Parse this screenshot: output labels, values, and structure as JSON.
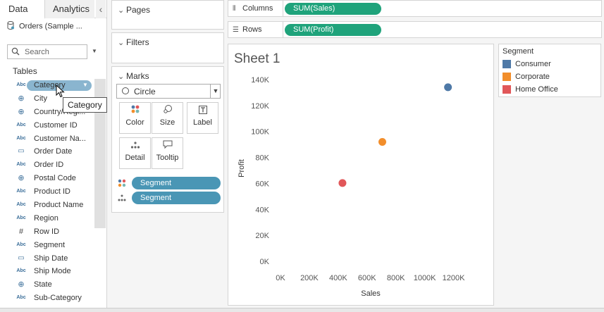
{
  "data_pane": {
    "tabs": [
      {
        "label": "Data"
      },
      {
        "label": "Analytics"
      }
    ],
    "collapse_glyph": "‹",
    "datasource": "Orders (Sample ...",
    "search": {
      "placeholder": "Search"
    },
    "tables_header": "Tables",
    "fields": [
      {
        "name": "Category",
        "type": "Abc",
        "icon": "abc-icon"
      },
      {
        "name": "City",
        "type": "globe",
        "icon": "globe-icon"
      },
      {
        "name": "Country/Regi...",
        "type": "globe",
        "icon": "globe-icon"
      },
      {
        "name": "Customer ID",
        "type": "Abc",
        "icon": "abc-icon"
      },
      {
        "name": "Customer Na...",
        "type": "Abc",
        "icon": "abc-icon"
      },
      {
        "name": "Order Date",
        "type": "date",
        "icon": "calendar-icon"
      },
      {
        "name": "Order ID",
        "type": "Abc",
        "icon": "abc-icon"
      },
      {
        "name": "Postal Code",
        "type": "globe",
        "icon": "globe-icon"
      },
      {
        "name": "Product ID",
        "type": "Abc",
        "icon": "abc-icon"
      },
      {
        "name": "Product Name",
        "type": "Abc",
        "icon": "abc-icon"
      },
      {
        "name": "Region",
        "type": "Abc",
        "icon": "abc-icon"
      },
      {
        "name": "Row ID",
        "type": "number",
        "icon": "hash-icon"
      },
      {
        "name": "Segment",
        "type": "Abc",
        "icon": "abc-icon"
      },
      {
        "name": "Ship Date",
        "type": "date",
        "icon": "calendar-icon"
      },
      {
        "name": "Ship Mode",
        "type": "Abc",
        "icon": "abc-icon"
      },
      {
        "name": "State",
        "type": "globe",
        "icon": "globe-icon"
      },
      {
        "name": "Sub-Category",
        "type": "Abc",
        "icon": "abc-icon"
      }
    ],
    "tooltip": "Category"
  },
  "cards": {
    "pages": "Pages",
    "filters": "Filters",
    "marks": "Marks",
    "mark_type": "Circle",
    "buttons": {
      "color": "Color",
      "size": "Size",
      "label": "Label",
      "detail": "Detail",
      "tooltip": "Tooltip"
    },
    "mark_pills": [
      {
        "label": "Segment",
        "encoding": "color"
      },
      {
        "label": "Segment",
        "encoding": "detail"
      }
    ]
  },
  "shelves": {
    "columns": {
      "label": "Columns",
      "pill": "SUM(Sales)"
    },
    "rows": {
      "label": "Rows",
      "pill": "SUM(Profit)"
    }
  },
  "sheet": {
    "title": "Sheet 1"
  },
  "legend": {
    "title": "Segment",
    "items": [
      {
        "label": "Consumer",
        "color": "#4e79a7"
      },
      {
        "label": "Corporate",
        "color": "#f28e2b"
      },
      {
        "label": "Home Office",
        "color": "#e15759"
      }
    ]
  },
  "colors": {
    "green_pill": "#1fa37b",
    "blue_pill": "#4a96b5"
  },
  "chart_data": {
    "type": "scatter",
    "xlabel": "Sales",
    "ylabel": "Profit",
    "x_ticks": [
      "0K",
      "200K",
      "400K",
      "600K",
      "800K",
      "1000K",
      "1200K"
    ],
    "y_ticks": [
      "0K",
      "20K",
      "40K",
      "60K",
      "80K",
      "100K",
      "120K",
      "140K"
    ],
    "xlim": [
      0,
      1300000
    ],
    "ylim": [
      0,
      140000
    ],
    "grid": false,
    "series": [
      {
        "name": "Consumer",
        "color": "#4e79a7",
        "x": 1161401,
        "y": 134119
      },
      {
        "name": "Corporate",
        "color": "#f28e2b",
        "x": 706146,
        "y": 91979
      },
      {
        "name": "Home Office",
        "color": "#e15759",
        "x": 429653,
        "y": 60299
      }
    ]
  }
}
